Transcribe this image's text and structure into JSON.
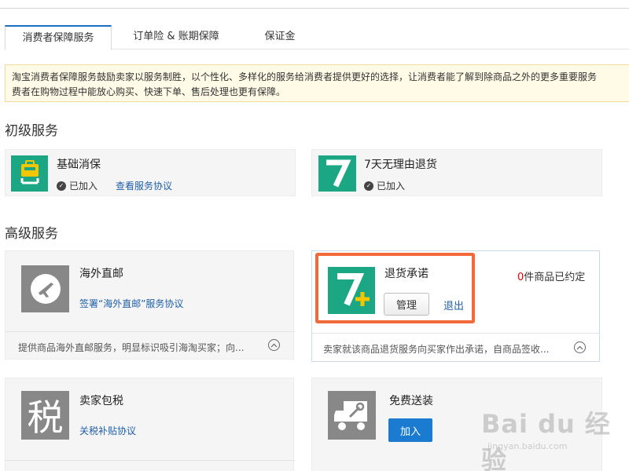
{
  "tabs": [
    {
      "label": "消费者保障服务"
    },
    {
      "label": "订单险 & 账期保障"
    },
    {
      "label": "保证金"
    }
  ],
  "notice": {
    "line1": "淘宝消费者保障服务鼓励卖家以服务制胜，以个性化、多样化的服务给消费者提供更好的选择，让消费者能了解到除商品之外的更多重要服务",
    "line2": "费者在购物过程中能放心购买、快速下单、售后处理也更有保障。"
  },
  "basic": {
    "title": "初级服务",
    "cards": [
      {
        "name": "基础消保",
        "status": "已加入",
        "link": "查看服务协议",
        "icon": "bag-icon",
        "color": "#1ba784"
      },
      {
        "name": "7天无理由退货",
        "status": "已加入",
        "icon": "seven-icon",
        "color": "#1ba784"
      }
    ]
  },
  "advanced": {
    "title": "高级服务",
    "cards": [
      {
        "name": "海外直邮",
        "link": "签署“海外直邮”服务协议",
        "desc": "提供商品海外直邮服务，明显标识吸引海淘买家；向...",
        "icon": "airplane-icon",
        "color": "#888888"
      },
      {
        "name": "退货承诺",
        "count_prefix": "0",
        "count_suffix": "件商品已约定",
        "manage": "管理",
        "exit": "退出",
        "desc": "卖家就该商品退货服务向买家作出承诺，自商品签收...",
        "icon": "seven-plus-icon",
        "color": "#1ba784"
      },
      {
        "name": "卖家包税",
        "link": "关税补贴协议",
        "icon_text": "税",
        "icon": "tax-icon",
        "color": "#888888"
      },
      {
        "name": "免费送装",
        "join": "加入",
        "icon": "install-truck-icon",
        "color": "#888888"
      }
    ]
  },
  "watermark": {
    "main": "Bai du 经验",
    "sub": "jingyan.baidu.com"
  }
}
